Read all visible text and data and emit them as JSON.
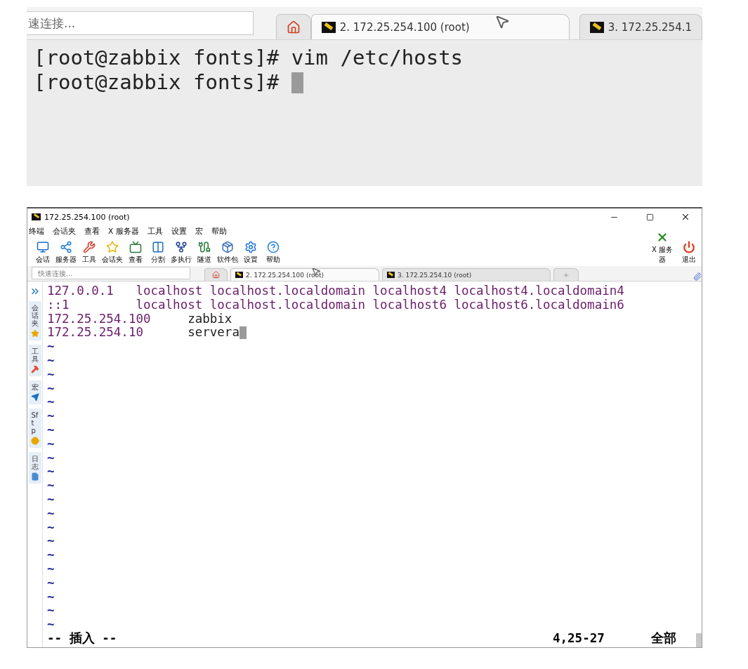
{
  "zoomed_view": {
    "quick_connect": {
      "placeholder": "速连接..."
    },
    "tabs": [
      {
        "kind": "home",
        "selected": false
      },
      {
        "kind": "session",
        "label": "2. 172.25.254.100 (root)",
        "selected": true
      },
      {
        "kind": "session",
        "label": "3. 172.25.254.1",
        "selected": false
      }
    ],
    "lines": [
      "[root@zabbix fonts]# vim /etc/hosts",
      "[root@zabbix fonts]# "
    ]
  },
  "window": {
    "title": "172.25.254.100 (root)",
    "menu": [
      "终端",
      "会话夹",
      "查看",
      "X 服务器",
      "工具",
      "设置",
      "宏",
      "帮助"
    ],
    "toolbar": [
      "会话",
      "服务器",
      "工具",
      "会话夹",
      "查看",
      "分割",
      "多执行",
      "隧道",
      "软件包",
      "设置",
      "帮助"
    ],
    "toolbar_right": [
      "X 服务器",
      "退出"
    ],
    "quick_connect": {
      "placeholder": "快速连接..."
    },
    "tabs": [
      {
        "kind": "home",
        "selected": false
      },
      {
        "kind": "session",
        "label": "2. 172.25.254.100 (root)",
        "selected": true
      },
      {
        "kind": "session",
        "label": "3. 172.25.254.10 (root)",
        "selected": false
      },
      {
        "kind": "new",
        "selected": false
      }
    ],
    "sidebar": [
      "会话夹",
      "工具",
      "宏",
      "Sftp",
      "日志"
    ],
    "hosts": [
      {
        "kind": "syntax",
        "address": "127.0.0.1",
        "names": "localhost localhost.localdomain localhost4 localhost4.localdomain4"
      },
      {
        "kind": "syntax",
        "address": "::1",
        "names": "localhost localhost.localdomain localhost6 localhost6.localdomain6"
      },
      {
        "kind": "plain",
        "address": "172.25.254.100",
        "names": "zabbix"
      },
      {
        "kind": "plain",
        "address": "172.25.254.10",
        "names": "servera",
        "cursor": true
      }
    ],
    "empty_lines": [
      "~",
      "~",
      "~",
      "~",
      "~",
      "~",
      "~",
      "~",
      "~",
      "~",
      "~",
      "~",
      "~",
      "~",
      "~",
      "~",
      "~",
      "~",
      "~",
      "~",
      "~"
    ],
    "status": {
      "mode": "-- 插入 --",
      "position": "4,25-27",
      "scroll": "全部"
    }
  }
}
